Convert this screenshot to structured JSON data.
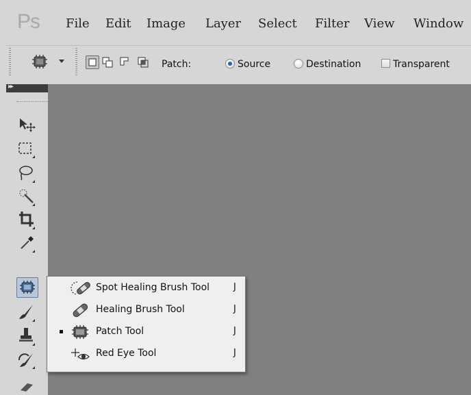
{
  "app": {
    "logo": "Ps"
  },
  "menubar": {
    "items": [
      "File",
      "Edit",
      "Image",
      "Layer",
      "Select",
      "Filter",
      "View",
      "Window"
    ]
  },
  "options": {
    "patch_label": "Patch:",
    "source_label": "Source",
    "destination_label": "Destination",
    "transparent_label": "Transparent",
    "patch_mode": "Source",
    "transparent_checked": false
  },
  "tools": {
    "items": [
      "move-tool",
      "marquee-tool",
      "lasso-tool",
      "quick-selection-tool",
      "crop-tool",
      "eyedropper-tool",
      "healing-tool",
      "brush-tool",
      "clone-stamp-tool",
      "history-brush-tool"
    ],
    "active": "healing-tool"
  },
  "flyout": {
    "items": [
      {
        "label": "Spot Healing Brush Tool",
        "shortcut": "J",
        "icon": "spot-healing-brush-icon",
        "selected": false
      },
      {
        "label": "Healing Brush Tool",
        "shortcut": "J",
        "icon": "healing-brush-icon",
        "selected": false
      },
      {
        "label": "Patch Tool",
        "shortcut": "J",
        "icon": "patch-icon",
        "selected": true
      },
      {
        "label": "Red Eye Tool",
        "shortcut": "J",
        "icon": "red-eye-icon",
        "selected": false
      }
    ]
  },
  "colors": {
    "chrome": "#d6d6d6",
    "canvas": "#808080",
    "active_tool_bg": "#b8c8dc",
    "radio_selected": "#2d5fbf",
    "panel_header": "#3c3c3c"
  }
}
